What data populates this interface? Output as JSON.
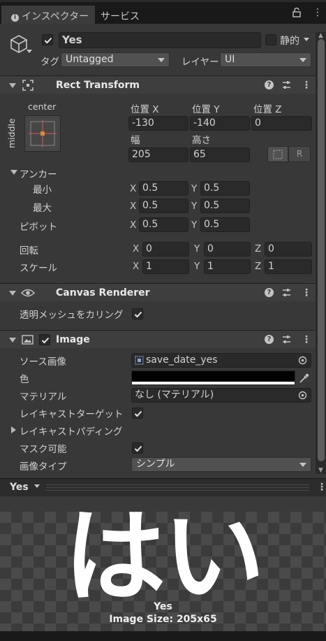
{
  "tabs": {
    "inspector": "インスペクター",
    "services": "サービス"
  },
  "object": {
    "name": "Yes",
    "static_label": "静的",
    "tag_label": "タグ",
    "tag_value": "Untagged",
    "layer_label": "レイヤー",
    "layer_value": "UI"
  },
  "rect_transform": {
    "title": "Rect Transform",
    "anchor_preset_h": "center",
    "anchor_preset_v": "middle",
    "pos_x_label": "位置 X",
    "pos_y_label": "位置 Y",
    "pos_z_label": "位置 Z",
    "pos_x": "-130",
    "pos_y": "-140",
    "pos_z": "0",
    "width_label": "幅",
    "height_label": "高さ",
    "width": "205",
    "height": "65",
    "raw_button": "R",
    "anchors_label": "アンカー",
    "min_label": "最小",
    "max_label": "最大",
    "pivot_label": "ピボット",
    "min_x": "0.5",
    "min_y": "0.5",
    "max_x": "0.5",
    "max_y": "0.5",
    "pivot_x": "0.5",
    "pivot_y": "0.5",
    "rotation_label": "回転",
    "scale_label": "スケール",
    "rot_x": "0",
    "rot_y": "0",
    "rot_z": "0",
    "scale_x": "1",
    "scale_y": "1",
    "scale_z": "1",
    "axis_x": "X",
    "axis_y": "Y",
    "axis_z": "Z"
  },
  "canvas_renderer": {
    "title": "Canvas Renderer",
    "cull_label": "透明メッシュをカリング"
  },
  "image": {
    "title": "Image",
    "source_label": "ソース画像",
    "source_value": "save_date_yes",
    "color_label": "色",
    "color_value": "#000000",
    "material_label": "マテリアル",
    "material_value": "なし (マテリアル)",
    "raycast_target_label": "レイキャストターゲット",
    "raycast_padding_label": "レイキャストパディング",
    "maskable_label": "マスク可能",
    "image_type_label": "画像タイプ",
    "image_type_value": "シンプル"
  },
  "preview": {
    "dropdown": "Yes",
    "glyph": "はい",
    "name": "Yes",
    "size": "Image Size: 205x65"
  },
  "colors": {
    "background": "#383838",
    "field": "#2a2a2a",
    "header": "#3e3e3e",
    "tab_bar": "#191919"
  }
}
